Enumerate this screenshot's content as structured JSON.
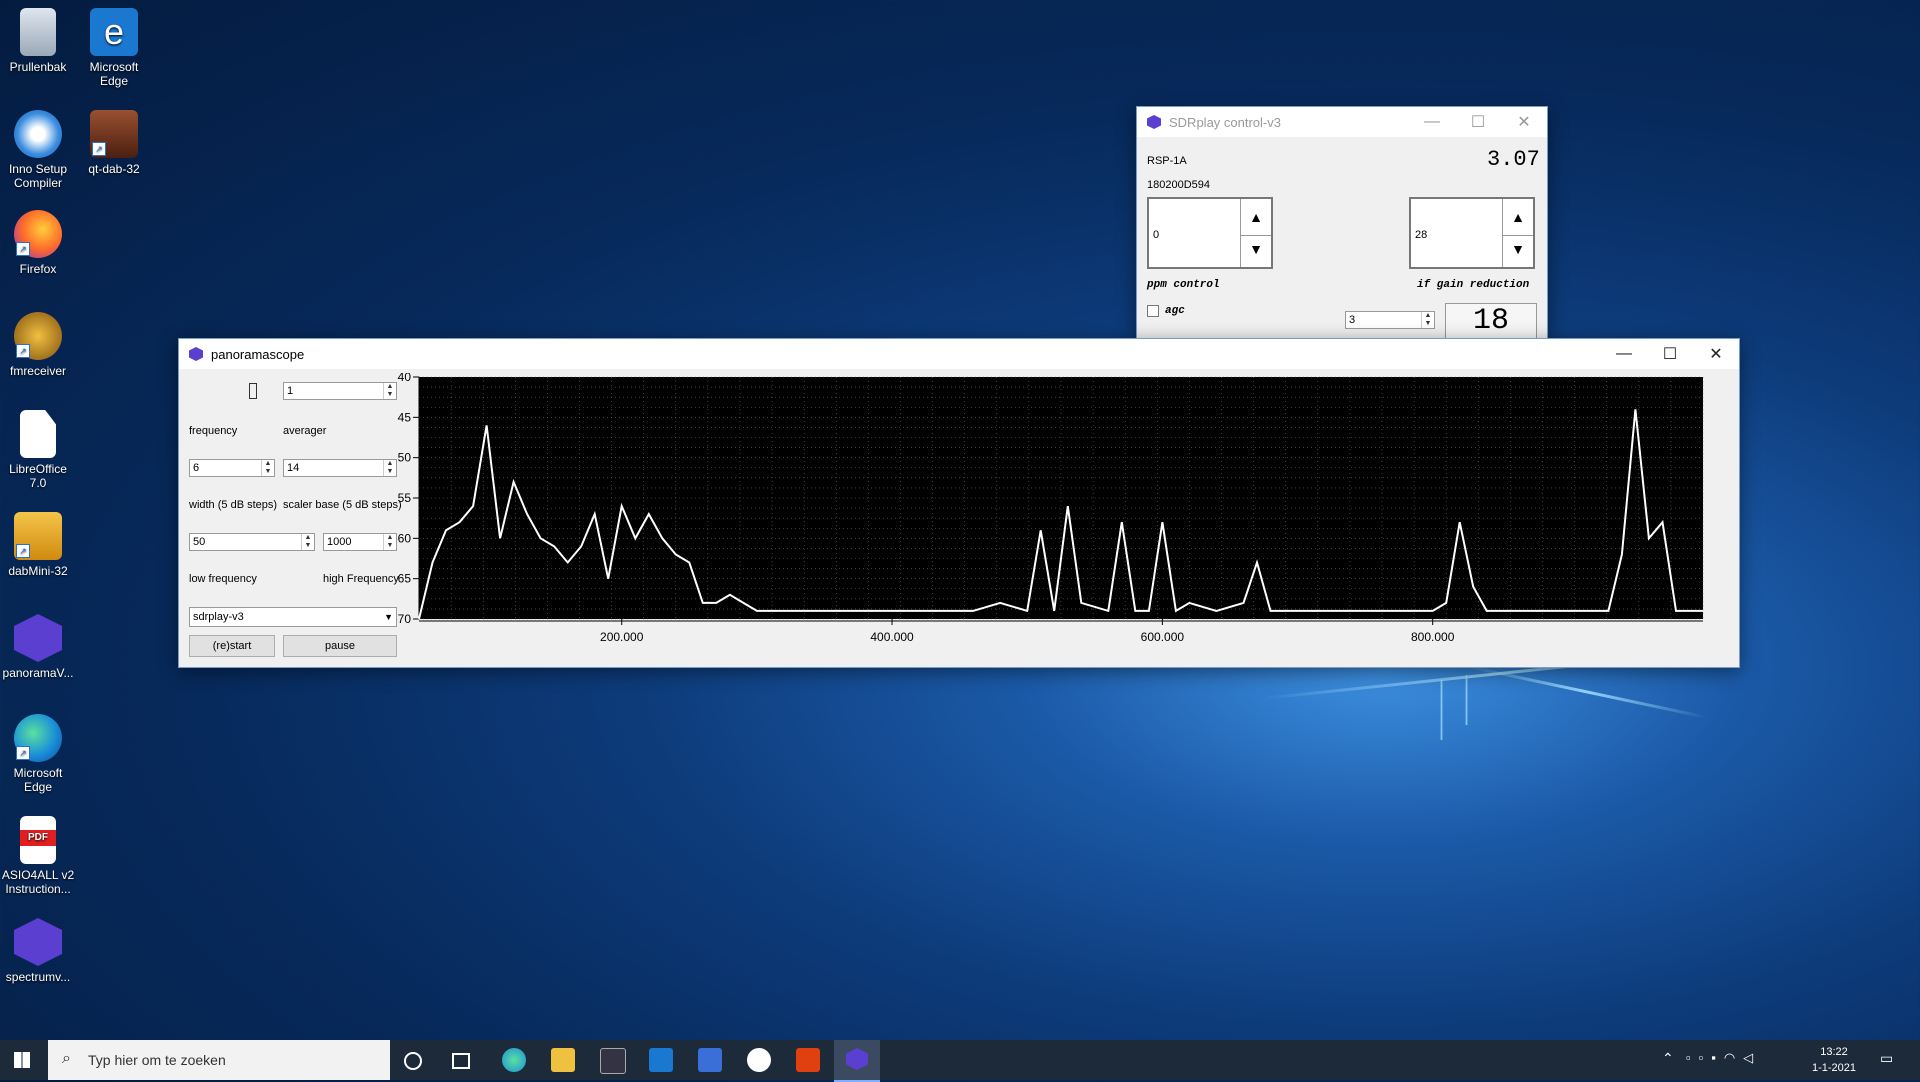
{
  "desktop": {
    "icons": [
      {
        "label": "Prullenbak"
      },
      {
        "label": "Microsoft Edge"
      },
      {
        "label": "Inno Setup Compiler"
      },
      {
        "label": "qt-dab-32"
      },
      {
        "label": "Firefox"
      },
      {
        "label": "fmreceiver"
      },
      {
        "label": "LibreOffice 7.0"
      },
      {
        "label": "dabMini-32"
      },
      {
        "label": "panoramaV..."
      },
      {
        "label": "Microsoft Edge"
      },
      {
        "label": "ASIO4ALL v2 Instruction..."
      },
      {
        "label": "spectrumv..."
      }
    ]
  },
  "sdrplay": {
    "title": "SDRplay control-v3",
    "device": "RSP-1A",
    "serial": "180200D594",
    "version_display": "3.07",
    "ppm_value": "0",
    "ppm_label": "ppm control",
    "if_gain_value": "28",
    "if_gain_label": "if gain reduction",
    "agc_label": "agc",
    "lna_value": "3",
    "lna_display": "18"
  },
  "panorama": {
    "title": "panoramascope",
    "averager_value": "1",
    "frequency_label": "frequency",
    "averager_label": "averager",
    "width_value": "6",
    "scaler_value": "14",
    "width_label": "width (5 dB steps)",
    "scaler_label": "scaler base (5 dB steps)",
    "low_value": "50",
    "high_value": "1000",
    "low_label": "low frequency",
    "high_label": "high Frequency",
    "device_select": "sdrplay-v3",
    "restart_label": "(re)start",
    "pause_label": "pause"
  },
  "chart_data": {
    "type": "line",
    "y_ticks": [
      "-40",
      "-45",
      "-50",
      "-55",
      "-60",
      "-65",
      "-70"
    ],
    "ylim": [
      -70,
      -40
    ],
    "x_ticks": [
      "200.000",
      "400.000",
      "600.000",
      "800.000"
    ],
    "xlim": [
      50,
      1000
    ],
    "grid": true,
    "series": [
      {
        "x": [
          50,
          60,
          70,
          80,
          90,
          100,
          110,
          120,
          130,
          140,
          150,
          160,
          170,
          180,
          190,
          200,
          210,
          220,
          230,
          240,
          250,
          260,
          270,
          280,
          290,
          300,
          320,
          340,
          360,
          380,
          400,
          420,
          440,
          460,
          480,
          500,
          510,
          520,
          530,
          540,
          560,
          570,
          580,
          590,
          600,
          610,
          620,
          640,
          660,
          670,
          680,
          700,
          720,
          740,
          760,
          780,
          800,
          810,
          820,
          830,
          840,
          860,
          880,
          900,
          920,
          930,
          940,
          950,
          960,
          970,
          980,
          990,
          1000
        ],
        "values": [
          -70,
          -63,
          -59,
          -58,
          -56,
          -46,
          -60,
          -53,
          -57,
          -60,
          -61,
          -63,
          -61,
          -57,
          -65,
          -56,
          -60,
          -57,
          -60,
          -62,
          -63,
          -68,
          -68,
          -67,
          -68,
          -69,
          -69,
          -69,
          -69,
          -69,
          -69,
          -69,
          -69,
          -69,
          -68,
          -69,
          -59,
          -69,
          -56,
          -68,
          -69,
          -58,
          -69,
          -69,
          -58,
          -69,
          -68,
          -69,
          -68,
          -63,
          -69,
          -69,
          -69,
          -69,
          -69,
          -69,
          -69,
          -68,
          -58,
          -66,
          -69,
          -69,
          -69,
          -69,
          -69,
          -69,
          -62,
          -44,
          -60,
          -58,
          -69,
          -69,
          -69
        ]
      }
    ]
  }
}
